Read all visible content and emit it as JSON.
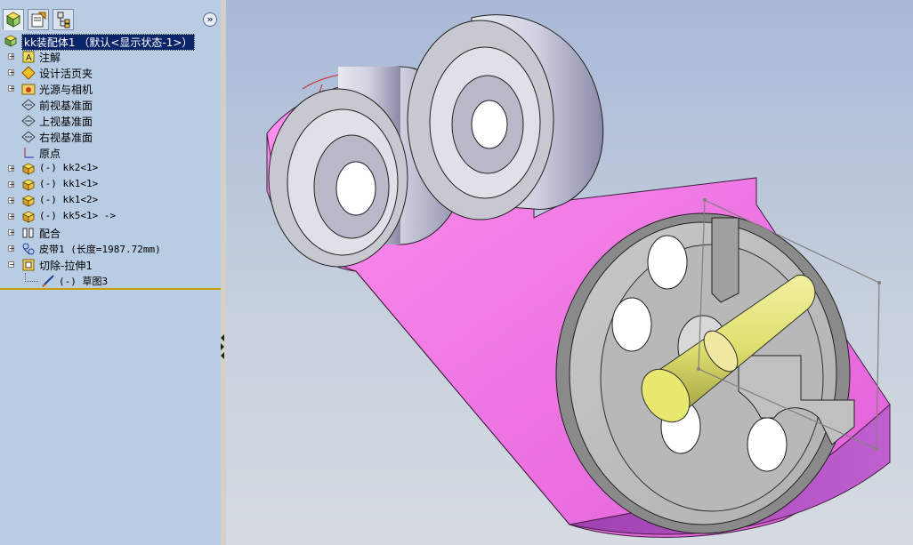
{
  "feature_manager": {
    "tabs": [
      "feature-manager-tab",
      "property-manager-tab",
      "configuration-manager-tab"
    ],
    "collapse_label": "»",
    "root": {
      "label": "kk装配体1  （默认<显示状态-1>）",
      "icon": "assembly-icon"
    },
    "items": [
      {
        "label": "注解",
        "icon": "annotations-icon",
        "expandable": true,
        "indent": 0
      },
      {
        "label": "设计活页夹",
        "icon": "design-binder-icon",
        "expandable": true,
        "indent": 0
      },
      {
        "label": "光源与相机",
        "icon": "lights-cameras-icon",
        "expandable": true,
        "indent": 0
      },
      {
        "label": "前视基准面",
        "icon": "plane-icon",
        "expandable": false,
        "indent": 0
      },
      {
        "label": "上视基准面",
        "icon": "plane-icon",
        "expandable": false,
        "indent": 0
      },
      {
        "label": "右视基准面",
        "icon": "plane-icon",
        "expandable": false,
        "indent": 0
      },
      {
        "label": "原点",
        "icon": "origin-icon",
        "expandable": false,
        "indent": 0
      },
      {
        "label": "(-) kk2<1>",
        "icon": "part-icon",
        "expandable": true,
        "indent": 0
      },
      {
        "label": "(-) kk1<1>",
        "icon": "part-icon",
        "expandable": true,
        "indent": 0
      },
      {
        "label": "(-) kk1<2>",
        "icon": "part-icon",
        "expandable": true,
        "indent": 0
      },
      {
        "label": "(-) kk5<1> ->",
        "icon": "part-icon",
        "expandable": true,
        "indent": 0
      },
      {
        "label": "配合",
        "icon": "mates-icon",
        "expandable": true,
        "indent": 0
      },
      {
        "label": "皮带1 (长度=1987.72mm)",
        "icon": "belt-chain-icon",
        "expandable": true,
        "indent": 0
      },
      {
        "label": "切除-拉伸1",
        "icon": "cut-extrude-icon",
        "expandable": true,
        "expanded": true,
        "indent": 0
      },
      {
        "label": "(-) 草图3",
        "icon": "sketch-icon",
        "expandable": false,
        "indent": 1
      }
    ]
  },
  "colors": {
    "panel_bg": "#b8cce4",
    "selection": "#0a246a",
    "belt": "#ff80f0",
    "shaft": "#e8e878",
    "metal": "#c8c8c8"
  }
}
